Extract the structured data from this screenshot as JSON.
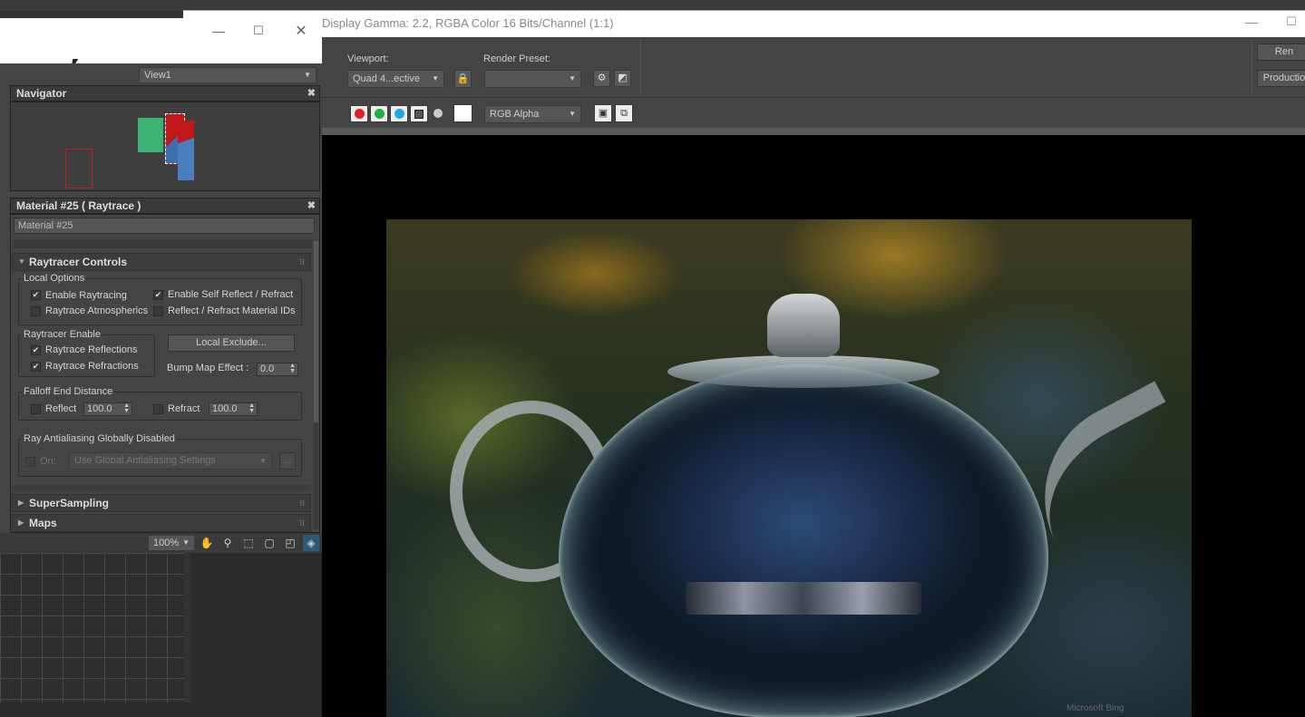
{
  "render_frame": {
    "title": "Display Gamma: 2.2, RGBA Color 16 Bits/Channel (1:1)",
    "viewport_label": "Viewport:",
    "viewport_value": "Quad 4...ective",
    "render_preset_label": "Render Preset:",
    "render_preset_value": "",
    "render_button": "Ren",
    "production_value": "Productio",
    "channel_value": "RGB Alpha",
    "watermark": "Microsoft Bing"
  },
  "material_editor": {
    "view_dropdown": "View1",
    "navigator_title": "Navigator",
    "material_title": "Material #25  ( Raytrace )",
    "material_name": "Material #25",
    "raytracer_controls": "Raytracer Controls",
    "local_options": "Local Options",
    "enable_raytracing": "Enable Raytracing",
    "enable_self_reflect": "Enable Self Reflect / Refract",
    "raytrace_atmospherics": "Raytrace Atmospherics",
    "reflect_refract_ids": "Reflect / Refract Material IDs",
    "raytracer_enable": "Raytracer Enable",
    "raytrace_reflections": "Raytrace Reflections",
    "raytrace_refractions": "Raytrace Refractions",
    "local_exclude": "Local Exclude...",
    "bump_map_label": "Bump Map Effect :",
    "bump_map_value": "0.0",
    "falloff_label": "Falloff End Distance",
    "reflect_label": "Reflect",
    "reflect_value": "100.0",
    "refract_label": "Refract",
    "refract_value": "100.0",
    "antialias_label": "Ray Antialiasing Globally Disabled",
    "on_label": "On:",
    "antialias_dd": "Use Global Antialiasing Settings",
    "ellipsis": "...",
    "supersampling": "SuperSampling",
    "maps": "Maps",
    "zoom_value": "100%"
  }
}
